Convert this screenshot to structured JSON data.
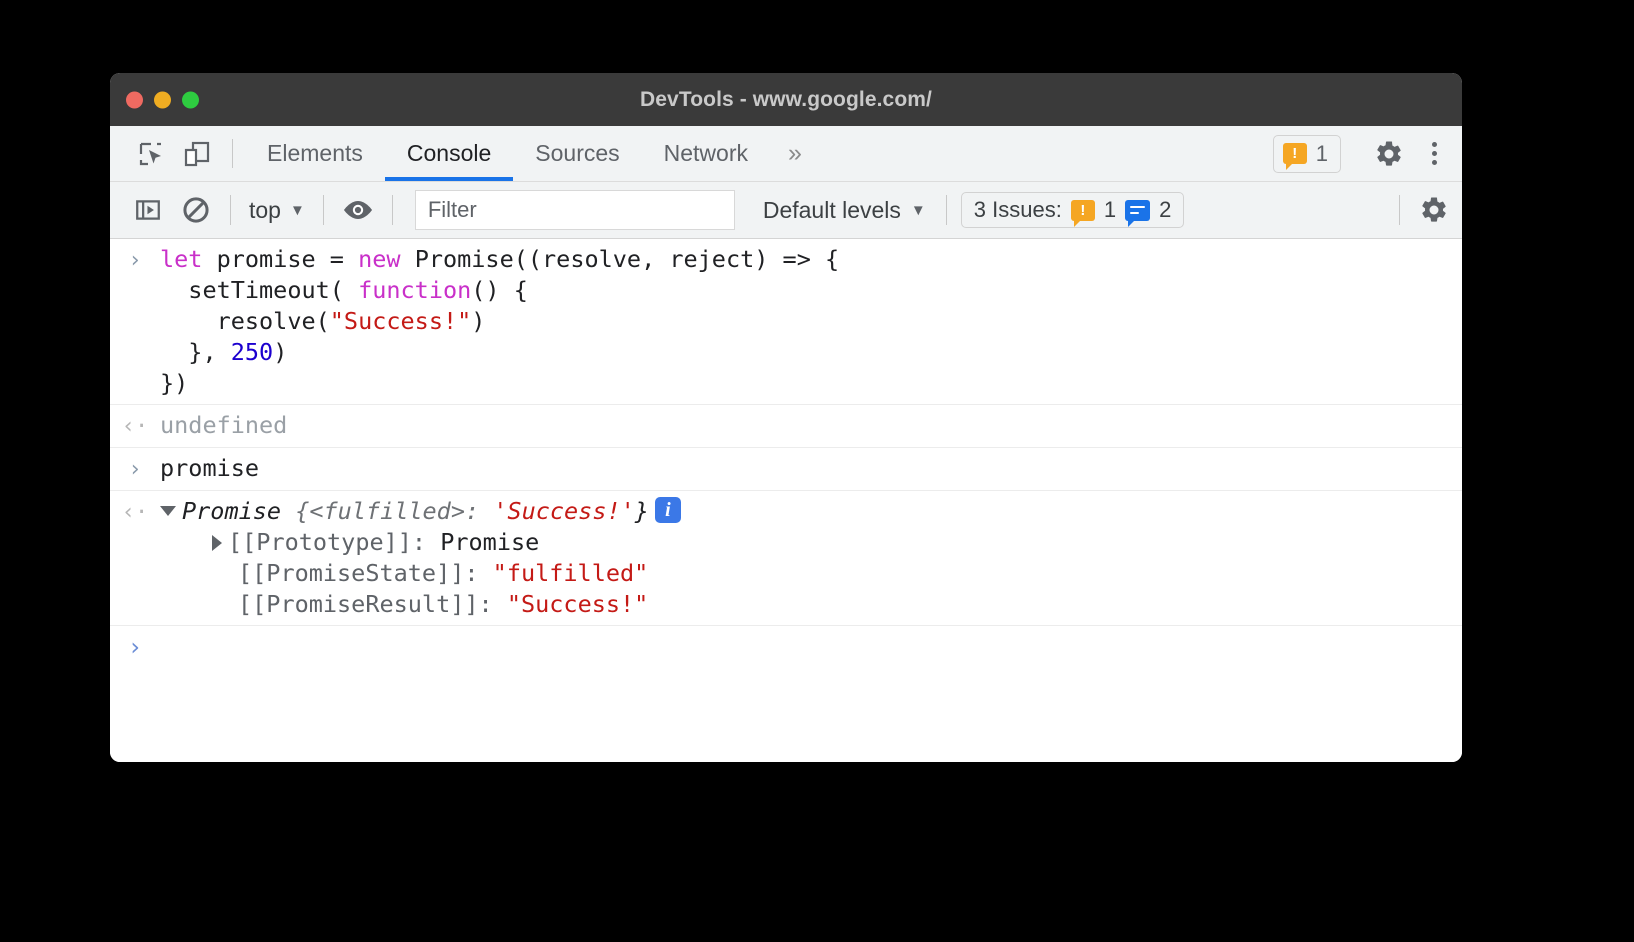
{
  "window": {
    "title": "DevTools - www.google.com/",
    "traffic_lights": [
      "close",
      "minimize",
      "zoom"
    ]
  },
  "tabbar": {
    "icons": [
      {
        "name": "inspect-element-icon",
        "label": "Inspect element"
      },
      {
        "name": "device-toolbar-icon",
        "label": "Toggle device toolbar"
      }
    ],
    "tabs": [
      {
        "label": "Elements",
        "active": false
      },
      {
        "label": "Console",
        "active": true
      },
      {
        "label": "Sources",
        "active": false
      },
      {
        "label": "Network",
        "active": false
      }
    ],
    "more_label": "»",
    "warning_badge": {
      "count": "1",
      "icon": "warning-icon"
    },
    "settings_label": "Settings",
    "menu_label": "Customize and control DevTools"
  },
  "console_toolbar": {
    "sidebar_toggle": "console-sidebar-toggle",
    "clear_console": "clear-console-icon",
    "context": {
      "label": "top",
      "caret": "▼"
    },
    "live_expression": "eye-icon",
    "filter": {
      "value": "",
      "placeholder": "Filter"
    },
    "levels": {
      "label": "Default levels",
      "caret": "▼"
    },
    "issues": {
      "label": "3 Issues:",
      "warning_count": "1",
      "info_count": "2"
    },
    "settings_label": "Console settings"
  },
  "console": {
    "entries": [
      {
        "type": "input",
        "gutter": "›",
        "lines": [
          [
            {
              "t": "let",
              "c": "kw"
            },
            {
              "t": " promise = ",
              "c": "plain"
            },
            {
              "t": "new",
              "c": "kw"
            },
            {
              "t": " Promise((resolve, reject) => {",
              "c": "plain"
            }
          ],
          [
            {
              "t": "  setTimeout( ",
              "c": "plain"
            },
            {
              "t": "function",
              "c": "kw"
            },
            {
              "t": "() {",
              "c": "plain"
            }
          ],
          [
            {
              "t": "    resolve(",
              "c": "plain"
            },
            {
              "t": "\"Success!\"",
              "c": "str"
            },
            {
              "t": ")",
              "c": "plain"
            }
          ],
          [
            {
              "t": "  }, ",
              "c": "plain"
            },
            {
              "t": "250",
              "c": "num"
            },
            {
              "t": ")",
              "c": "plain"
            }
          ],
          [
            {
              "t": "})",
              "c": "plain"
            }
          ]
        ]
      },
      {
        "type": "output",
        "gutter": "‹·",
        "text": "undefined"
      },
      {
        "type": "input",
        "gutter": "›",
        "lines": [
          [
            {
              "t": "promise",
              "c": "plain"
            }
          ]
        ]
      },
      {
        "type": "object",
        "gutter": "‹·",
        "header": {
          "expander": "triangle-down",
          "name": "Promise",
          "state": " {<fulfilled>: ",
          "value": "'Success!'",
          "close": "}",
          "info_pill": "i"
        },
        "properties": [
          {
            "expander": "triangle-right",
            "key": "[[Prototype]]: ",
            "value": "Promise",
            "value_class": "plain"
          },
          {
            "expander": "none",
            "key": "[[PromiseState]]: ",
            "value": "\"fulfilled\"",
            "value_class": "str"
          },
          {
            "expander": "none",
            "key": "[[PromiseResult]]: ",
            "value": "\"Success!\"",
            "value_class": "str"
          }
        ]
      },
      {
        "type": "prompt",
        "gutter": "›",
        "text": ""
      }
    ]
  },
  "colors": {
    "accent": "#1a73e8",
    "warning": "#f5a623",
    "info": "#1a73e8",
    "string": "#c41a16",
    "keyword": "#c930c9",
    "number": "#1c00cf",
    "titlebar": "#3a3a3a",
    "toolbar": "#f1f3f4"
  }
}
